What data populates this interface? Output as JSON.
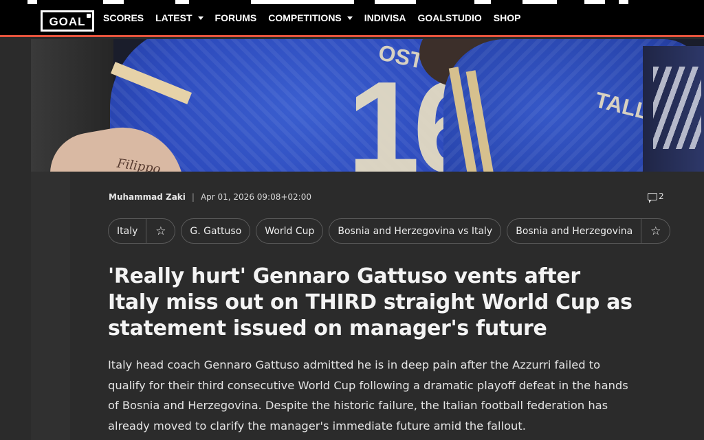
{
  "brand": {
    "logo_text": "GOAL"
  },
  "nav": {
    "items": [
      {
        "label": "SCORES",
        "has_dropdown": false
      },
      {
        "label": "LATEST",
        "has_dropdown": true
      },
      {
        "label": "FORUMS",
        "has_dropdown": false
      },
      {
        "label": "COMPETITIONS",
        "has_dropdown": true
      },
      {
        "label": "INDIVISA",
        "has_dropdown": false
      },
      {
        "label": "GOALSTUDIO",
        "has_dropdown": false
      },
      {
        "label": "SHOP",
        "has_dropdown": false
      }
    ],
    "accent_color": "#e5533d"
  },
  "hero": {
    "jersey_number": "16",
    "jersey_name_left": "OSTO",
    "jersey_name_right": "TALLI",
    "tattoo_text": "Filippo"
  },
  "article": {
    "author": "Muhammad Zaki",
    "separator": "|",
    "timestamp": "Apr 01, 2026 09:08+02:00",
    "comment_count": "2",
    "tags": [
      {
        "label": "Italy",
        "followable": true
      },
      {
        "label": "G. Gattuso",
        "followable": false
      },
      {
        "label": "World Cup",
        "followable": false
      },
      {
        "label": "Bosnia and Herzegovina vs Italy",
        "followable": false
      },
      {
        "label": "Bosnia and Herzegovina",
        "followable": true
      }
    ],
    "headline_lines": [
      "'Really hurt' Gennaro Gattuso vents after",
      "Italy miss out on THIRD straight World Cup as",
      "statement issued on manager's future"
    ],
    "summary_lines": [
      "Italy head coach Gennaro Gattuso admitted he is in deep pain after the Azzurri failed to",
      "qualify for their third consecutive World Cup following a dramatic playoff defeat in the hands",
      "of Bosnia and Herzegovina. Despite the historic failure, the Italian football federation has",
      "already moved to clarify the manager's immediate future amid the fallout."
    ]
  }
}
